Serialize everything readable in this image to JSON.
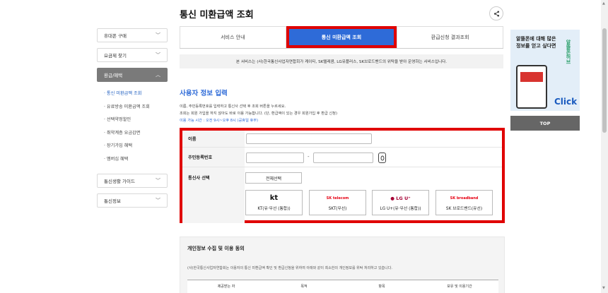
{
  "page": {
    "title": "통신 미환급액 조회",
    "share_icon": "share-icon"
  },
  "sidebar": {
    "items": [
      {
        "label": "휴대폰 구매"
      },
      {
        "label": "요금제 찾기"
      },
      {
        "label": "환급/혜택"
      },
      {
        "label": "통신생활 가이드"
      },
      {
        "label": "통신정보"
      }
    ],
    "sub_items": [
      {
        "label": "· 통신 미환급액 조회"
      },
      {
        "label": "· 유료방송 미환급액 조회"
      },
      {
        "label": "· 선택약정할인"
      },
      {
        "label": "· 취약계층 요금감면"
      },
      {
        "label": "· 장기가입 혜택"
      },
      {
        "label": "· 멤버십 혜택"
      }
    ]
  },
  "tabs": [
    {
      "label": "서비스 안내"
    },
    {
      "label": "통신 미환급액 조회"
    },
    {
      "label": "환급신청 결과조회"
    }
  ],
  "notice": "본 서비스는 (사)한국통신사업자연합회가 케이티, SK텔레콤, LG유플러스, SK브로드밴드의 위탁을 받아 운영하는 서비스입니다.",
  "user_info": {
    "title": "사용자 정보 입력",
    "desc_line1": "이름, 주민등록번호를 입력하고 통신사 선택 후 조회 버튼을 누르세요.",
    "desc_line2": "조회는 회원 가입을 하지 않아도 바로 이용 가능합니다. (단, 환급액이 있는 경우 회원가입 후 환급 신청)",
    "desc_line3": "이용 가능 시간 : 오전 9시~오후 8시 (공휴일 휴무)"
  },
  "form": {
    "name_label": "이름",
    "name_value": "",
    "rrn_label": "주민등록번호",
    "rrn_front": "",
    "rrn_dash": "-",
    "rrn_back": "",
    "eye_icon": "eye-icon",
    "carrier_label": "통신사 선택",
    "select_all": "전체선택",
    "carriers": [
      {
        "logo": "kt",
        "name": "KT(유·무선 (통합))"
      },
      {
        "logo": "SK telecom",
        "name": "SKT(무선)"
      },
      {
        "logo": "● LG U⁺",
        "name": "LG U+(유·무선 (통합))"
      },
      {
        "logo": "SK broadband",
        "name": "SK 브로드밴드(유선)"
      }
    ]
  },
  "consent": {
    "title": "개인정보 수집 및 이용 동의",
    "text": "(사)한국통신사업자연합회는 이용자의 통신 미환급액 확인 및 환급신청을 위하여 아래와 같이 최소한의 개인정보를 위탁 처리하고 있습니다.",
    "columns": [
      "제공받는 자",
      "목적",
      "항목",
      "보유 및 이용기간"
    ]
  },
  "ad": {
    "text": "알뜰폰에 대해 많은 정보를 얻고 싶다면",
    "side": "알뜰폰허브",
    "click": "Click"
  },
  "top_button": "TOP",
  "colors": {
    "accent": "#2e6bd8",
    "highlight_border": "#e00000",
    "sidebar_active": "#7a7a7a"
  }
}
